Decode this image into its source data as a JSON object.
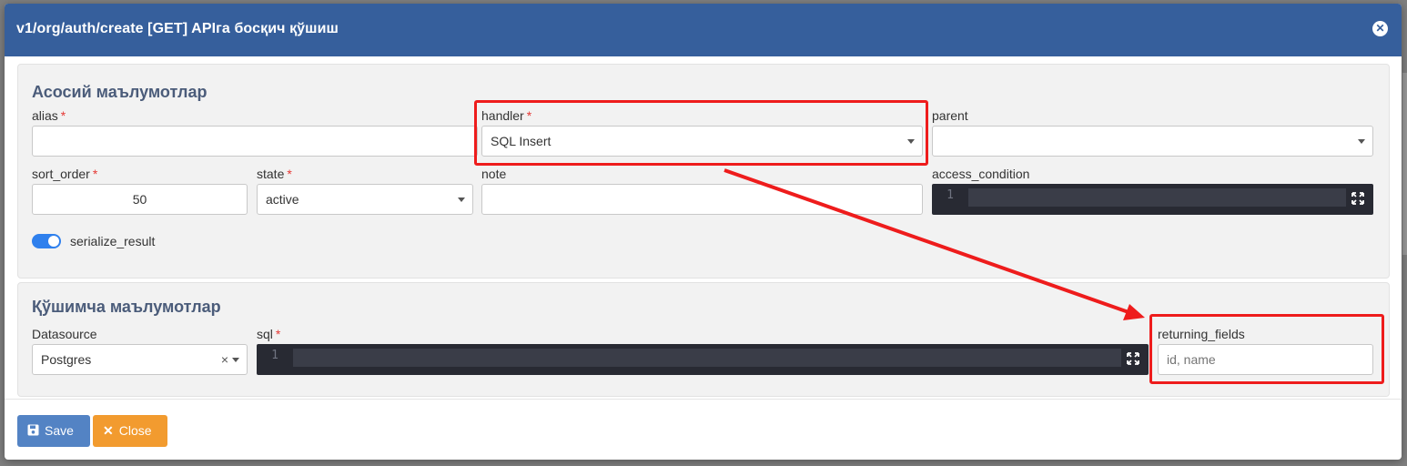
{
  "modal": {
    "title": "v1/org/auth/create [GET] APIга босқич қўшиш",
    "close_icon": "close-circle-icon"
  },
  "basic": {
    "title": "Асосий маълумотлар",
    "alias": {
      "label": "alias",
      "value": ""
    },
    "handler": {
      "label": "handler",
      "value": "SQL Insert"
    },
    "parent": {
      "label": "parent",
      "value": ""
    },
    "sort_order": {
      "label": "sort_order",
      "value": "50"
    },
    "state": {
      "label": "state",
      "value": "active"
    },
    "note": {
      "label": "note",
      "value": ""
    },
    "access_condition": {
      "label": "access_condition",
      "line_number": "1"
    },
    "serialize_result": {
      "label": "serialize_result",
      "checked": true
    }
  },
  "extra": {
    "title": "Қўшимча маълумотлар",
    "datasource": {
      "label": "Datasource",
      "value": "Postgres"
    },
    "sql": {
      "label": "sql",
      "line_number": "1"
    },
    "returning_fields": {
      "label": "returning_fields",
      "placeholder": "id, name",
      "value": ""
    }
  },
  "footer": {
    "save_label": "Save",
    "close_label": "Close",
    "save_icon": "floppy-disk-icon",
    "close_icon": "x-icon"
  },
  "colors": {
    "header": "#365f9c",
    "save_button": "#5383c4",
    "close_button": "#f29b2f",
    "highlight": "#ee1c1c",
    "toggle": "#2f80ed"
  }
}
